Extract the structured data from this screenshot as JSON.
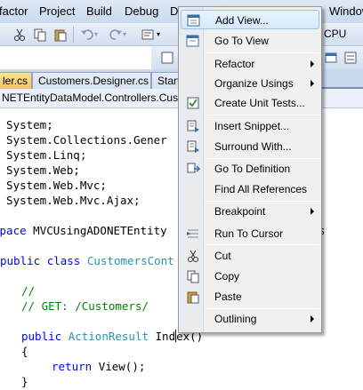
{
  "menubar": {
    "items": [
      "factor",
      "Project",
      "Build",
      "Debug",
      "D",
      "Window"
    ]
  },
  "toolbar": {
    "cpu_label": "CPU"
  },
  "tabs": [
    {
      "label": "ler.cs",
      "active": true
    },
    {
      "label": "Customers.Designer.cs",
      "active": false
    },
    {
      "label": "Start",
      "active": false
    }
  ],
  "navbar": {
    "combo_text": "NETEntityDataModel.Controllers.Custon"
  },
  "code": {
    "lines": [
      [
        "g System;"
      ],
      [
        "g System.Collections.Gener"
      ],
      [
        "g System.Linq;"
      ],
      [
        "g System.Web;"
      ],
      [
        "g System.Web.Mvc;"
      ],
      [
        "g System.Web.Mvc.Ajax;"
      ],
      [
        ""
      ],
      [
        "space MVCUsingADONETEntity",
        "s"
      ],
      [
        ""
      ],
      [
        "public class CustomersCont"
      ],
      [
        ""
      ],
      [
        "    //"
      ],
      [
        "    // GET: /Customers/"
      ],
      [
        ""
      ],
      [
        "    public ActionResult Index()"
      ],
      [
        "    {"
      ],
      [
        "        return View();"
      ],
      [
        "    }"
      ]
    ],
    "l_space": "space",
    "l_ns": "MVCUsingADONETEntity",
    "l_s": "s",
    "l_public": "public",
    "l_class": "class",
    "l_customerscont": "CustomersCont",
    "l_comment1": "//",
    "l_comment2": "// GET: /Customers/",
    "l_public2": "public",
    "l_actionresult": "ActionResult",
    "l_index_a": "Ind",
    "l_index_b": "ex()",
    "l_brace_open": "{",
    "l_return": "return",
    "l_view": "View();",
    "l_brace_close": "}",
    "using_lines": [
      "g System;",
      "g System.Collections.Gener",
      "g System.Linq;",
      "g System.Web;",
      "g System.Web.Mvc;",
      "g System.Web.Mvc.Ajax;"
    ]
  },
  "context_menu": {
    "items": [
      {
        "label": "Add View...",
        "icon": "add-view-icon",
        "highlighted": true
      },
      {
        "label": "Go To View",
        "icon": "go-to-view-icon"
      },
      {
        "label": "Refactor",
        "submenu": true
      },
      {
        "label": "Organize Usings",
        "submenu": true
      },
      {
        "label": "Create Unit Tests...",
        "icon": "unit-test-icon"
      },
      {
        "label": "Insert Snippet...",
        "icon": "insert-snippet-icon"
      },
      {
        "label": "Surround With...",
        "icon": "surround-with-icon"
      },
      {
        "label": "Go To Definition",
        "icon": "go-to-definition-icon"
      },
      {
        "label": "Find All References"
      },
      {
        "label": "Breakpoint",
        "submenu": true
      },
      {
        "label": "Run To Cursor",
        "icon": "run-to-cursor-icon"
      },
      {
        "label": "Cut",
        "icon": "scissors-icon"
      },
      {
        "label": "Copy",
        "icon": "copy-icon"
      },
      {
        "label": "Paste",
        "icon": "paste-icon"
      },
      {
        "label": "Outlining",
        "submenu": true
      }
    ]
  },
  "colors": {
    "keyword": "#0000ff",
    "type": "#2b91af",
    "comment": "#008000",
    "active_tab": "#f4c35a",
    "highlight": "#d6e8fb"
  }
}
